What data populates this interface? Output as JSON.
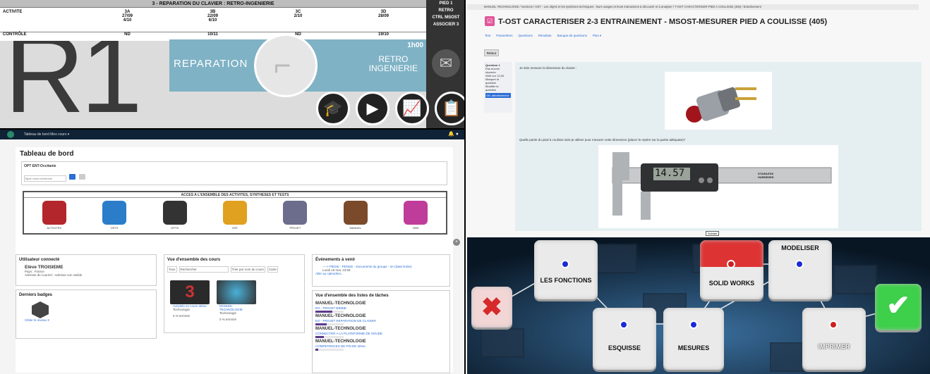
{
  "q1": {
    "header_title": "3 - REPARATION DU CLAVIER : RETRO-INGENIERIE",
    "row_activite_label": "ACTIVITE",
    "row_controle_label": "CONTRÔLE",
    "cols": [
      {
        "name": "3A",
        "d1": "27/09",
        "d2": "4/10",
        "ctrl": "ND"
      },
      {
        "name": "3B",
        "d1": "22/09",
        "d2": "6/10",
        "ctrl": "10/11"
      },
      {
        "name": "3C",
        "d1": "2/10",
        "d2": "",
        "ctrl": "ND"
      },
      {
        "name": "3D",
        "d1": "28/09",
        "d2": "",
        "ctrl": "19/10"
      }
    ],
    "right_l1": "PIED 1",
    "right_l2": "RETRO",
    "right_l3": "CTRL MSOST",
    "right_l4": "ASSOCIER 3",
    "big": "R1",
    "banner_left": "REPARATION",
    "banner_right_1": "RETRO",
    "banner_right_2": "INGENIERIE",
    "banner_duration": "1h00"
  },
  "q2": {
    "nav_items": "Tableau de bord   Mes cours ▾",
    "title": "Tableau de bord",
    "search_section": "OPT ENT-Occitanie",
    "search_placeholder": "Taper votre recherche",
    "access_title": "ACCES A L'ENSEMBLE DES ACTIVITES, SYNTHESES ET TESTS",
    "icons": [
      {
        "label": "ACTIVITES",
        "color": "#b3262c"
      },
      {
        "label": "OSTS",
        "color": "#2b7dc9"
      },
      {
        "label": "OPTS",
        "color": "#333333"
      },
      {
        "label": "OST",
        "color": "#e0a020"
      },
      {
        "label": "PROJET",
        "color": "#6c6c8c"
      },
      {
        "label": "MANUEL",
        "color": "#7a4a2a"
      },
      {
        "label": "SMS",
        "color": "#c03c9a"
      }
    ],
    "user_card_title": "Utilisateur connecté",
    "user_name": "Elève TROISIEME",
    "user_country": "Pays : France",
    "user_email": "Adresse de courriel : Adresse non visible",
    "badges_title": "Derniers badges",
    "badge_caption": "Cibler le niveau 3",
    "courses_title": "Vue d'ensemble des cours",
    "courses_filter": "Tous",
    "courses_search": "Rechercher",
    "courses_sort": "Trier par nom du cours",
    "courses_view": "Carte",
    "course1_name": "Activités en cours 3ème",
    "course1_cat": "Technologie",
    "course1_pct": "0 % terminé",
    "course2_name": "MANUEL TECHNOLOGIE",
    "course2_cat": "Technologie",
    "course2_pct": "0 % terminé",
    "events_title": "Événements à venir",
    "event_text": "----> PIEGE - PENGE - Documents du groupe - 3A (Date limite)",
    "event_date": "Lundi 16 mai, 23:59",
    "events_link": "Aller au calendrier...",
    "tasks_title": "Vue d'ensemble des listes de tâches",
    "tasks": [
      {
        "title": "MANUEL-TECHNOLOGIE",
        "sub": "EO - PROJET BIEBIE",
        "progress": 0.6
      },
      {
        "title": "MANUEL-TECHNOLOGIE",
        "sub": "EO - PROJET REPARATION DE CLAVIER",
        "progress": 0.4
      },
      {
        "title": "MANUEL-TECHNOLOGIE",
        "sub": "CONNECTER A LA PLATEFORME DE SOUDE",
        "progress": 0.3
      },
      {
        "title": "MANUEL-TECHNOLOGIE",
        "sub": "COMPETENCES DE FIN DE 3ème",
        "progress": 0.1
      }
    ]
  },
  "q3": {
    "breadcrumb": "MANUEL-TECHNOLOGIE / Sections / OST - Les objets et les systèmes techniques : leurs usages et leurs interactions à découvrir et à analyser / T-OST CARACTERISER PIED A COULISSE (405) / Entraînement",
    "title": "T-OST CARACTERISER 2-3 ENTRAINEMENT - MSOST-MESURER PIED A COULISSE (405)",
    "tabs": [
      "Test",
      "Paramètres",
      "Questions",
      "Résultats",
      "Banque de questions",
      "Plus ▾"
    ],
    "back": "Retour",
    "side_q": "Question 1",
    "side_lines": [
      "Pas encore",
      "répondu",
      "Noté sur 12,00",
      "Marquer la",
      "question",
      "Modifier la",
      "question"
    ],
    "side_btn": "Vid. attentivement",
    "q_text1": "Je dois mesurer la dimension du clavier :",
    "q_text2": "Quelle partie du pied à coulisse dois-je utiliser pour mesurer cette dimension (placer le repère sur la partie adéquate)?",
    "caliper_reading": "14.57",
    "caliper_brand": "STAINLESS HARDENED",
    "finish": "Suivant"
  },
  "q4": {
    "keys": [
      {
        "label": "LES FONCTIONS",
        "dot": "#1a2bd8"
      },
      {
        "label": "SOLID WORKS",
        "dot": "#cc2020"
      },
      {
        "label": "MODELISER",
        "dot": "#1a2bd8"
      },
      {
        "label": "ESQUISSE",
        "dot": "#1a2bd8"
      },
      {
        "label": "MESURES",
        "dot": "#1a2bd8"
      },
      {
        "label": "IMPRIMER",
        "dot": "#cc2020"
      }
    ]
  }
}
